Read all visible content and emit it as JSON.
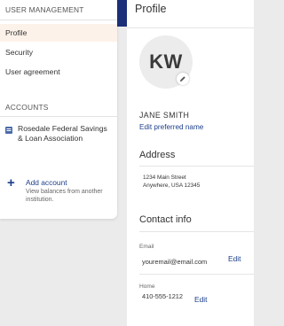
{
  "nav": {
    "user_management_heading": "USER MANAGEMENT",
    "items": [
      {
        "label": "Profile",
        "active": true
      },
      {
        "label": "Security",
        "active": false
      },
      {
        "label": "User agreement",
        "active": false
      }
    ],
    "accounts_heading": "ACCOUNTS",
    "account": {
      "name": "Rosedale Federal Savings & Loan Association",
      "icon": "bank-icon"
    },
    "add_account": {
      "label": "Add account",
      "description": "View balances from another institution.",
      "icon": "plus-icon"
    }
  },
  "profile": {
    "title": "Profile",
    "initials": "KW",
    "name": "JANE SMITH",
    "edit_name_label": "Edit preferred name",
    "address_heading": "Address",
    "address_line1": "1234 Main Street",
    "address_line2": "Anywhere, USA 12345",
    "contact_heading": "Contact info",
    "email_label": "Email",
    "email_value": "youremail@email.com",
    "email_edit": "Edit",
    "phone_label": "Home",
    "phone_value": "410-555-1212",
    "phone_edit": "Edit"
  },
  "colors": {
    "accent": "#1c2f78",
    "link": "#1c3f8a",
    "active_bg": "#fdf2e9",
    "page_bg": "#ebebeb"
  }
}
